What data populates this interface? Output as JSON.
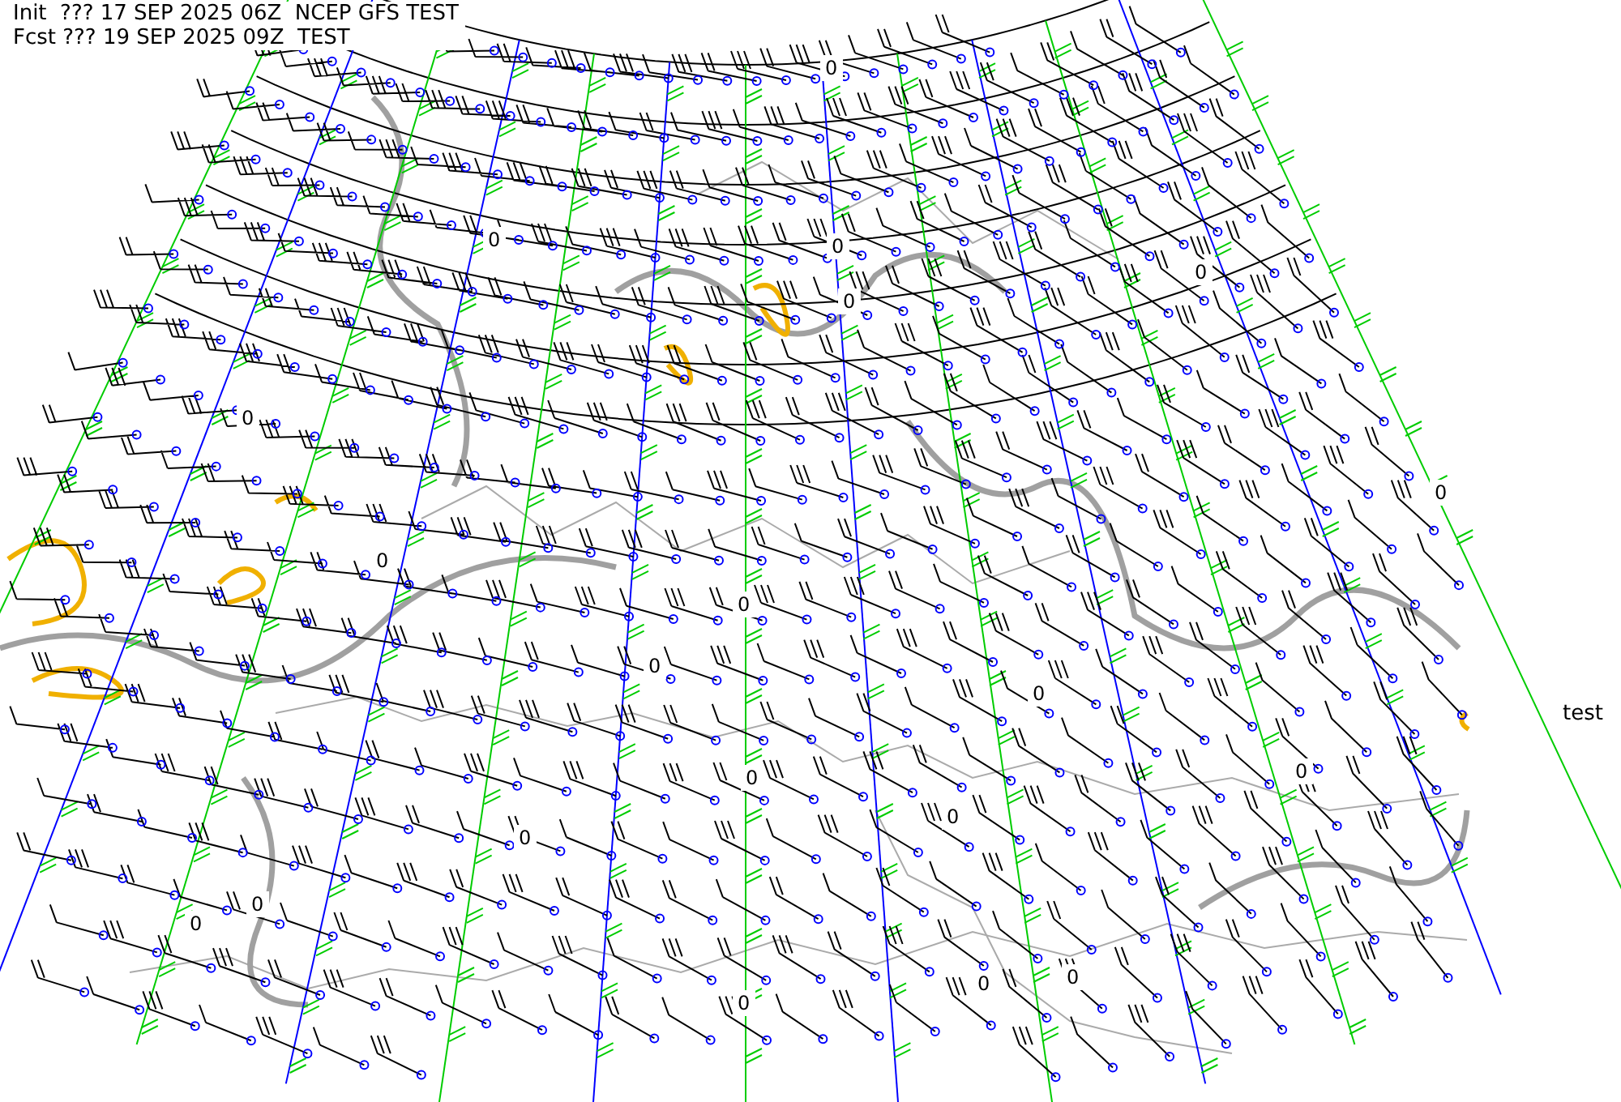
{
  "header": {
    "init_line": "Init  ??? 17 SEP 2025 06Z  NCEP GFS TEST",
    "forecast_line": "Fcst ??? 19 SEP 2025 09Z  TEST"
  },
  "side_label": "test",
  "contour_labels": [
    "0",
    "0",
    "0",
    "0",
    "0",
    "0",
    "0",
    "0",
    "0",
    "0",
    "0",
    "0",
    "0",
    "0",
    "0",
    "0",
    "0",
    "0",
    "0",
    "0"
  ]
}
